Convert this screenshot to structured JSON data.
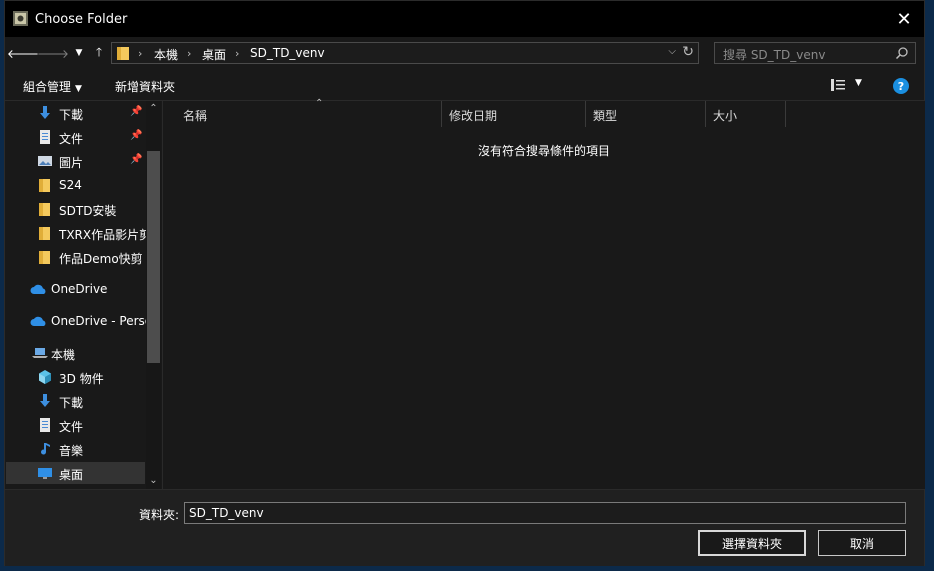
{
  "window": {
    "title": "Choose Folder"
  },
  "address_bar": {
    "crumbs": [
      "本機",
      "桌面",
      "SD_TD_venv"
    ]
  },
  "search": {
    "placeholder": "搜尋 SD_TD_venv"
  },
  "toolbar": {
    "organize_label": "組合管理",
    "new_folder_label": "新增資料夾"
  },
  "nav_pane": {
    "items": [
      {
        "label": "下載",
        "icon": "download-arrow-icon",
        "pinned": true
      },
      {
        "label": "文件",
        "icon": "document-icon",
        "pinned": true
      },
      {
        "label": "圖片",
        "icon": "pictures-icon",
        "pinned": true
      },
      {
        "label": "S24",
        "icon": "folder-icon"
      },
      {
        "label": "SDTD安裝",
        "icon": "folder-icon"
      },
      {
        "label": "TXRX作品影片剪",
        "icon": "folder-icon"
      },
      {
        "label": "作品Demo快剪",
        "icon": "folder-icon"
      },
      {
        "label": "OneDrive",
        "icon": "onedrive-cloud-icon"
      },
      {
        "label": "OneDrive - Perso",
        "icon": "onedrive-cloud-icon"
      },
      {
        "label": "本機",
        "icon": "this-pc-icon"
      },
      {
        "label": "3D 物件",
        "icon": "3d-objects-icon"
      },
      {
        "label": "下載",
        "icon": "download-arrow-icon"
      },
      {
        "label": "文件",
        "icon": "document-icon"
      },
      {
        "label": "音樂",
        "icon": "music-note-icon"
      },
      {
        "label": "桌面",
        "icon": "desktop-icon",
        "selected": true
      }
    ]
  },
  "columns": [
    "名稱",
    "修改日期",
    "類型",
    "大小"
  ],
  "content": {
    "empty_message": "沒有符合搜尋條件的項目"
  },
  "bottom": {
    "folder_label": "資料夾:",
    "folder_value": "SD_TD_venv",
    "select_button": "選擇資料夾",
    "cancel_button": "取消"
  },
  "colors": {
    "accent": "#1a8fe0",
    "folder": "#f4c95d",
    "background": "#191919"
  }
}
